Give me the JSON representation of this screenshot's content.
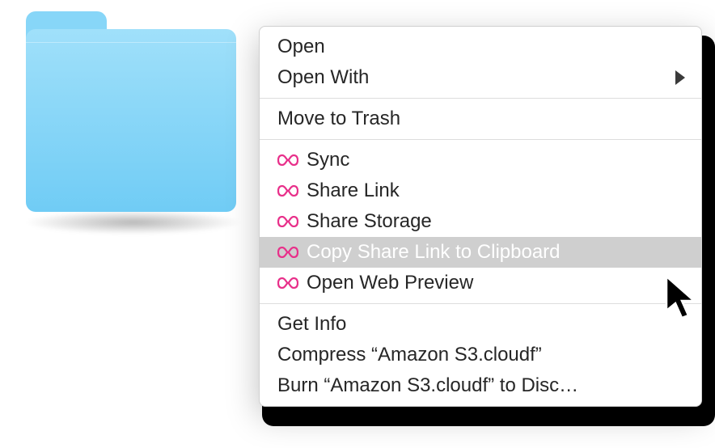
{
  "folder": {
    "color_top": "#a0e0fa",
    "color_bottom": "#70ccf5"
  },
  "menu": {
    "group1": [
      {
        "label": "Open",
        "submenu": false
      },
      {
        "label": "Open With",
        "submenu": true
      }
    ],
    "group2": [
      {
        "label": "Move to Trash",
        "submenu": false
      }
    ],
    "group3": [
      {
        "label": "Sync",
        "icon": "infinity-icon"
      },
      {
        "label": "Share Link",
        "icon": "infinity-icon"
      },
      {
        "label": "Share Storage",
        "icon": "infinity-icon"
      },
      {
        "label": "Copy Share Link to Clipboard",
        "icon": "infinity-icon",
        "highlight": true
      },
      {
        "label": "Open Web Preview",
        "icon": "infinity-icon"
      }
    ],
    "group4": [
      {
        "label": "Get Info"
      },
      {
        "label": "Compress “Amazon S3.cloudf”"
      },
      {
        "label": "Burn “Amazon S3.cloudf” to Disc…"
      }
    ]
  },
  "icon_colors": {
    "infinity": "#e8308a"
  }
}
